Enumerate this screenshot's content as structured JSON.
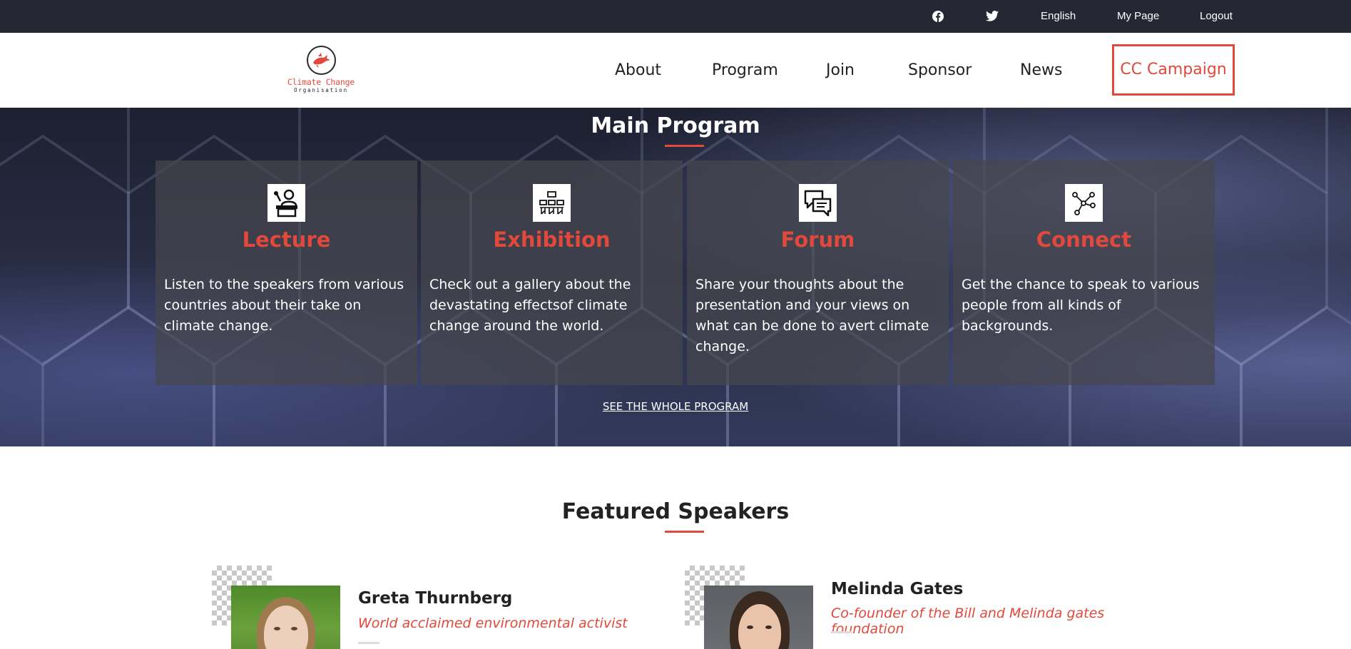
{
  "topbar": {
    "facebook_icon": "facebook-icon",
    "twitter_icon": "twitter-icon",
    "language": "English",
    "my_page": "My Page",
    "logout": "Logout"
  },
  "logo": {
    "name": "Climate Change",
    "sub": "Organisation"
  },
  "nav": {
    "items": [
      "About",
      "Program",
      "Join",
      "Sponsor",
      "News"
    ],
    "cta": "CC Campaign"
  },
  "program": {
    "title": "Main Program",
    "cards": [
      {
        "icon": "lecture-icon",
        "title": "Lecture",
        "text": "Listen to the speakers from various countries about their take on climate change."
      },
      {
        "icon": "exhibition-icon",
        "title": "Exhibition",
        "text": "Check out a gallery about the devastating effectsof climate change around the world."
      },
      {
        "icon": "forum-icon",
        "title": "Forum",
        "text": "Share your thoughts about the presentation and your views on what can be done to avert climate change."
      },
      {
        "icon": "connect-icon",
        "title": "Connect",
        "text": "Get the chance to speak to various people from all kinds of backgrounds."
      }
    ],
    "see_all": "SEE THE WHOLE PROGRAM"
  },
  "speakers": {
    "title": "Featured Speakers",
    "items": [
      {
        "name": "Greta Thurnberg",
        "role": "World acclaimed environmental activist"
      },
      {
        "name": "Melinda Gates",
        "role": "Co-founder of the Bill and Melinda gates foundation"
      }
    ]
  },
  "colors": {
    "accent": "#e0493b",
    "topbar_bg": "#252833",
    "text_dark": "#222222"
  }
}
